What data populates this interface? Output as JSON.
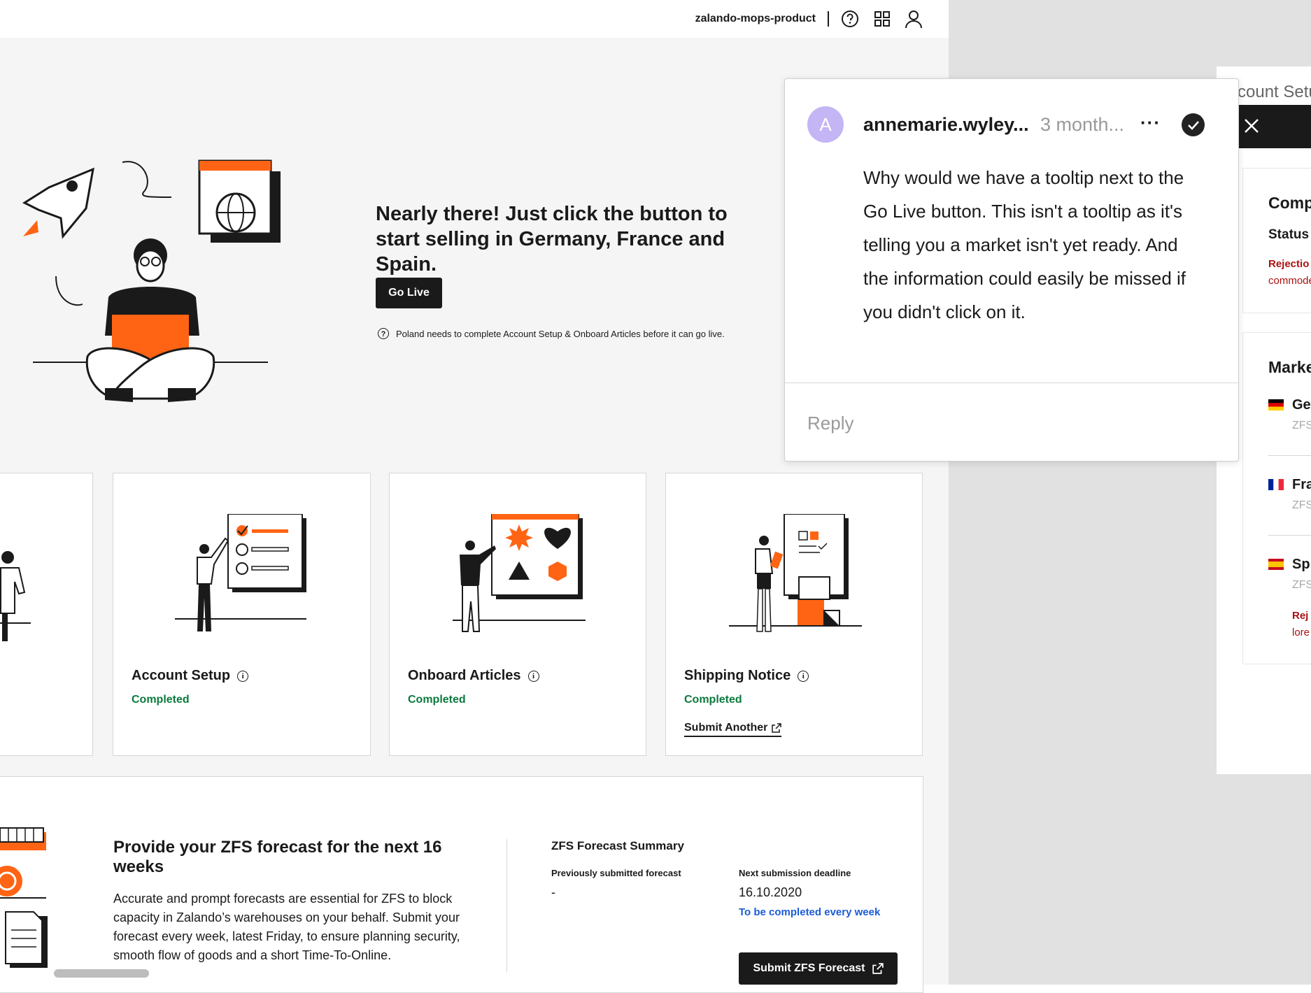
{
  "topbar": {
    "project": "zalando-mops-product",
    "icons": [
      "help-icon",
      "apps-grid-icon",
      "user-icon"
    ]
  },
  "hero": {
    "title": "Nearly there! Just click the button to start selling in Germany, France and Spain.",
    "go_live_label": "Go Live",
    "hint": "Poland needs to complete Account Setup & Onboard Articles before it can go live."
  },
  "cards": [
    {
      "title": "Account Setup",
      "status": "Completed"
    },
    {
      "title": "Onboard Articles",
      "status": "Completed"
    },
    {
      "title": "Shipping Notice",
      "status": "Completed",
      "link": "Submit Another"
    }
  ],
  "forecast": {
    "title": "Provide your ZFS forecast for the next 16 weeks",
    "text": "Accurate and prompt forecasts are essential for ZFS to block capacity in Zalando’s warehouses on your behalf. Submit your forecast every week, latest Friday, to ensure planning security, smooth flow of goods and a short Time-To-Online.",
    "summary_title": "ZFS Forecast Summary",
    "prev_label": "Previously submitted forecast",
    "prev_value": "-",
    "next_label": "Next submission deadline",
    "next_value": "16.10.2020",
    "next_note": "To be completed every week",
    "button": "Submit ZFS Forecast"
  },
  "side": {
    "header": "count Setu",
    "comp": "Comp",
    "status": "Status",
    "rejection": "Rejectio",
    "commodity": "commode",
    "markets": "Marke",
    "items": [
      {
        "name": "Ge",
        "sub": "ZFS"
      },
      {
        "name": "Fra",
        "sub": "ZFS"
      },
      {
        "name": "Sp",
        "sub": "ZFS",
        "rej": "Rej",
        "lore": "lore"
      }
    ]
  },
  "comment": {
    "avatar": "A",
    "author": "annemarie.wyley...",
    "time": "3 month...",
    "more": "···",
    "text": "Why would we have a tooltip next to the Go Live button. This isn't a tooltip as it's telling you a market isn't yet ready. And the information could easily be missed if you didn't click on it.",
    "reply_placeholder": "Reply"
  },
  "colors": {
    "accent": "#ff6414",
    "success": "#0b7a3e",
    "link": "#1a5bd6",
    "dark": "#1a1a1a",
    "avatar": "#c4b5f5"
  }
}
